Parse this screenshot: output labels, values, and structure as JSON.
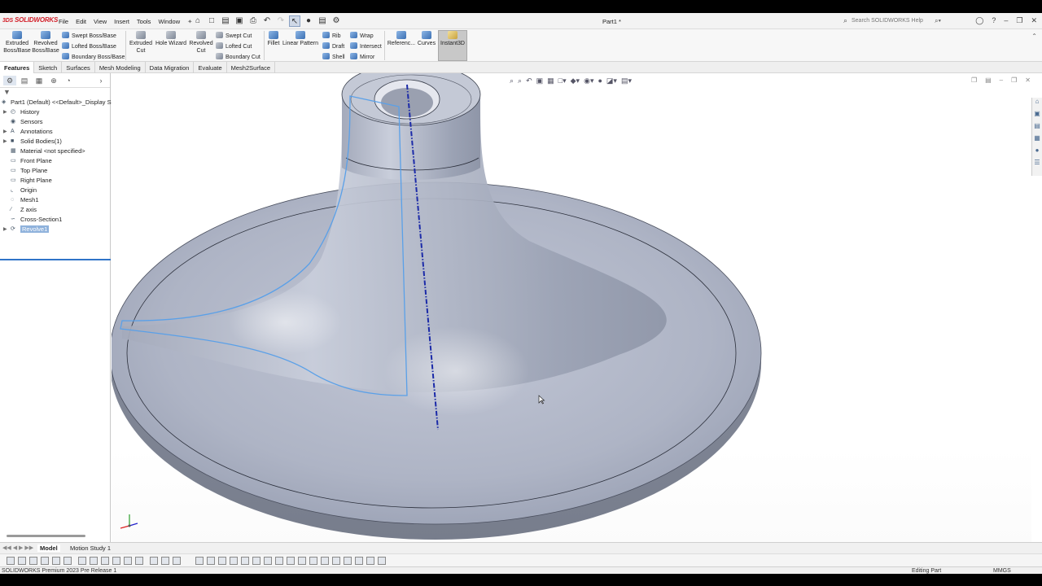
{
  "app": {
    "logo_ds": "3DS",
    "logo_text": "SOLIDWORKS",
    "document_title": "Part1 *",
    "search_placeholder": "Search SOLIDWORKS Help"
  },
  "menu": [
    "File",
    "Edit",
    "View",
    "Insert",
    "Tools",
    "Window"
  ],
  "ribbon": {
    "extruded_boss": "Extruded Boss/Base",
    "revolved_boss": "Revolved Boss/Base",
    "swept_boss": "Swept Boss/Base",
    "lofted_boss": "Lofted Boss/Base",
    "boundary_boss": "Boundary Boss/Base",
    "extruded_cut": "Extruded Cut",
    "hole_wizard": "Hole Wizard",
    "revolved_cut": "Revolved Cut",
    "swept_cut": "Swept Cut",
    "lofted_cut": "Lofted Cut",
    "boundary_cut": "Boundary Cut",
    "fillet": "Fillet",
    "linear_pattern": "Linear Pattern",
    "rib": "Rib",
    "draft": "Draft",
    "shell": "Shell",
    "wrap": "Wrap",
    "intersect": "Intersect",
    "mirror": "Mirror",
    "reference": "Referenc...",
    "curves": "Curves",
    "instant3d": "Instant3D"
  },
  "tabs": [
    "Features",
    "Sketch",
    "Surfaces",
    "Mesh Modeling",
    "Data Migration",
    "Evaluate",
    "Mesh2Surface"
  ],
  "tree": {
    "root": "Part1 (Default) <<Default>_Display S",
    "items": [
      {
        "label": "History",
        "icon": "history-icon"
      },
      {
        "label": "Sensors",
        "icon": "sensors-icon"
      },
      {
        "label": "Annotations",
        "icon": "annotations-icon"
      },
      {
        "label": "Solid Bodies(1)",
        "icon": "solid-bodies-icon"
      },
      {
        "label": "Material <not specified>",
        "icon": "material-icon"
      },
      {
        "label": "Front Plane",
        "icon": "plane-icon"
      },
      {
        "label": "Top Plane",
        "icon": "plane-icon"
      },
      {
        "label": "Right Plane",
        "icon": "plane-icon"
      },
      {
        "label": "Origin",
        "icon": "origin-icon"
      },
      {
        "label": "Mesh1",
        "icon": "mesh-icon"
      },
      {
        "label": "Z axis",
        "icon": "axis-icon"
      },
      {
        "label": "Cross-Section1",
        "icon": "sketch-icon"
      },
      {
        "label": "Revolve1",
        "icon": "revolve-icon"
      }
    ]
  },
  "bottom_tabs": {
    "model": "Model",
    "motion_study": "Motion Study 1"
  },
  "status": {
    "version": "SOLIDWORKS Premium 2023 Pre Release 1",
    "mode": "Editing Part",
    "units": "MMGS"
  },
  "colors": {
    "model_fill": "#a9afc0",
    "sketch_line": "#5aa0e8",
    "axis_line": "#1b2aa8",
    "selection": "#8fb2dc"
  }
}
